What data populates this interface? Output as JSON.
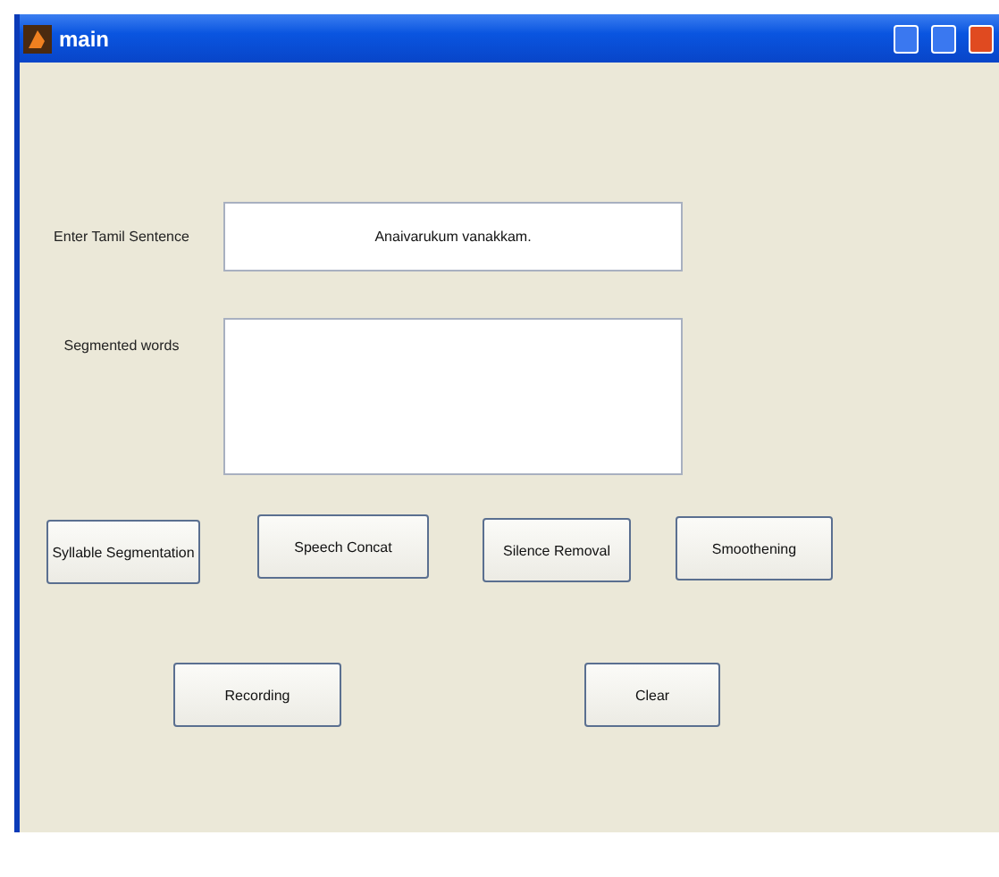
{
  "window": {
    "title": "main"
  },
  "fields": [
    {
      "label": "Enter Tamil Sentence",
      "value": "Anaivarukum vanakkam."
    },
    {
      "label": "Segmented words"
    }
  ],
  "buttons_row_1": [
    "Syllable Segmentation",
    "Speech Concat",
    "Silence Removal",
    "Smoothening"
  ],
  "buttons_row_2": [
    "Recording",
    "Clear"
  ]
}
